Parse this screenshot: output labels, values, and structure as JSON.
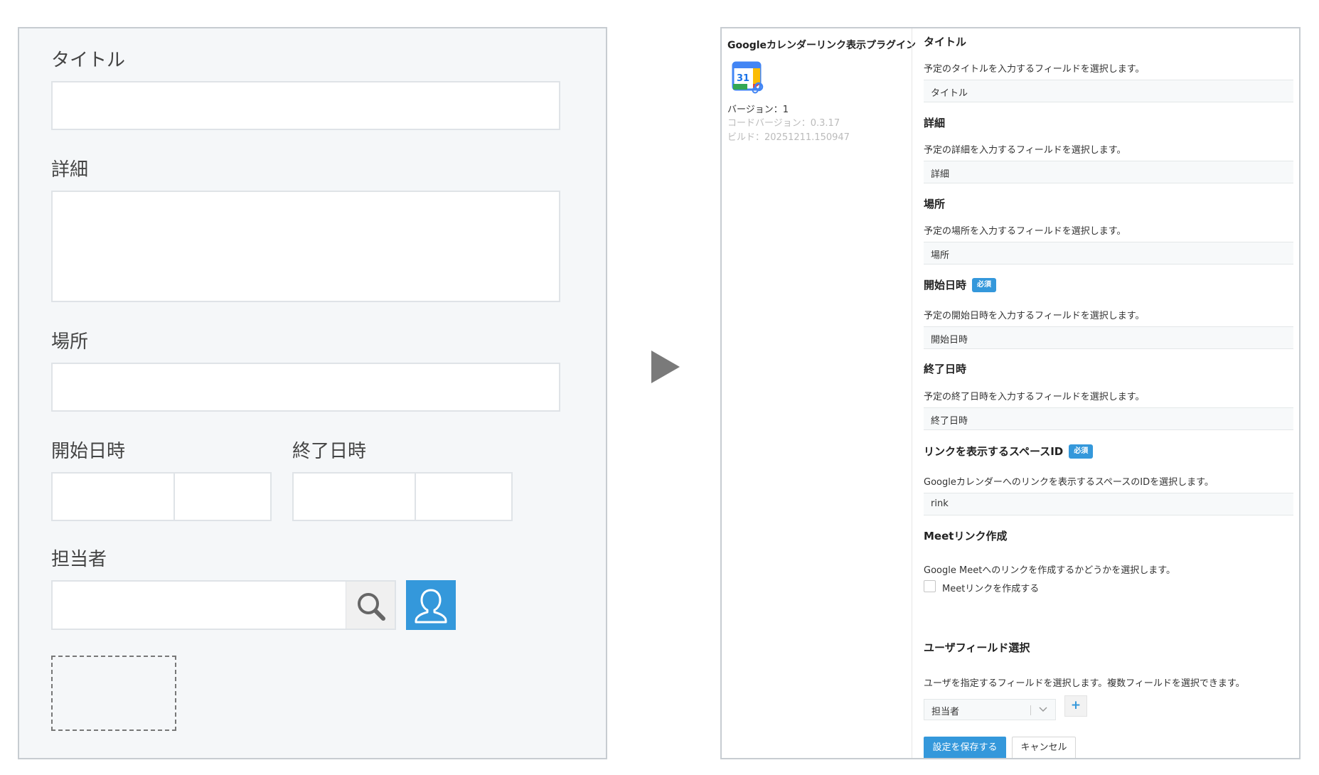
{
  "form_preview": {
    "title_label": "タイトル",
    "detail_label": "詳細",
    "location_label": "場所",
    "start_label": "開始日時",
    "end_label": "終了日時",
    "assignee_label": "担当者"
  },
  "plugin": {
    "name": "Googleカレンダーリンク表示プラグイン",
    "icon_text": "31",
    "version": "バージョン：1",
    "code_version": "コードバージョン：0.3.17",
    "build": "ビルド：20251211.150947"
  },
  "settings": {
    "required_badge": "必須",
    "title": {
      "label": "タイトル",
      "desc": "予定のタイトルを入力するフィールドを選択します。",
      "value": "タイトル"
    },
    "detail": {
      "label": "詳細",
      "desc": "予定の詳細を入力するフィールドを選択します。",
      "value": "詳細"
    },
    "location": {
      "label": "場所",
      "desc": "予定の場所を入力するフィールドを選択します。",
      "value": "場所"
    },
    "start": {
      "label": "開始日時",
      "desc": "予定の開始日時を入力するフィールドを選択します。",
      "value": "開始日時"
    },
    "end": {
      "label": "終了日時",
      "desc": "予定の終了日時を入力するフィールドを選択します。",
      "value": "終了日時"
    },
    "space": {
      "label": "リンクを表示するスペースID",
      "desc": "Googleカレンダーへのリンクを表示するスペースのIDを選択します。",
      "value": "rink"
    },
    "meet": {
      "label": "Meetリンク作成",
      "desc": "Google Meetへのリンクを作成するかどうかを選択します。",
      "checkbox_label": "Meetリンクを作成する",
      "checked": false
    },
    "user_field": {
      "label": "ユーザフィールド選択",
      "desc": "ユーザを指定するフィールドを選択します。複数フィールドを選択できます。",
      "value": "担当者",
      "add_label": "+"
    },
    "save_label": "設定を保存する",
    "cancel_label": "キャンセル"
  },
  "colors": {
    "accent": "#3498db",
    "panel_bg": "#f5f7f9",
    "border": "#c7ccd1"
  }
}
